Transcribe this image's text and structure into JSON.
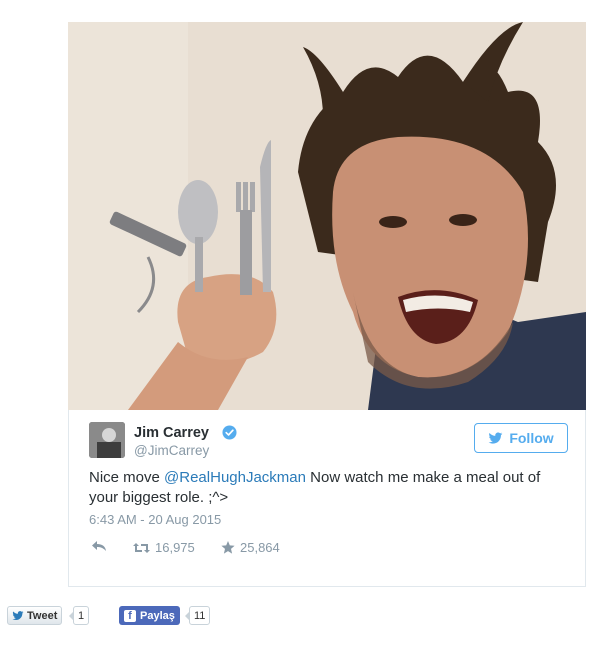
{
  "tweet": {
    "author": {
      "display_name": "Jim Carrey",
      "handle": "@JimCarrey",
      "verified": true
    },
    "follow_label": "Follow",
    "text_prefix": "Nice move ",
    "mention": "@RealHughJackman",
    "text_suffix": " Now watch me make a meal out of your biggest role. ;^>",
    "timestamp": "6:43 AM - 20 Aug 2015",
    "retweet_count": "16,975",
    "favorite_count": "25,864"
  },
  "share": {
    "tweet_label": "Tweet",
    "tweet_count": "1",
    "facebook_label": "Paylaş",
    "facebook_count": "11"
  },
  "colors": {
    "twitter_blue": "#55acee",
    "mention_blue": "#2b7bb9",
    "muted_gray": "#8899a6",
    "facebook_blue": "#4c69ba"
  }
}
